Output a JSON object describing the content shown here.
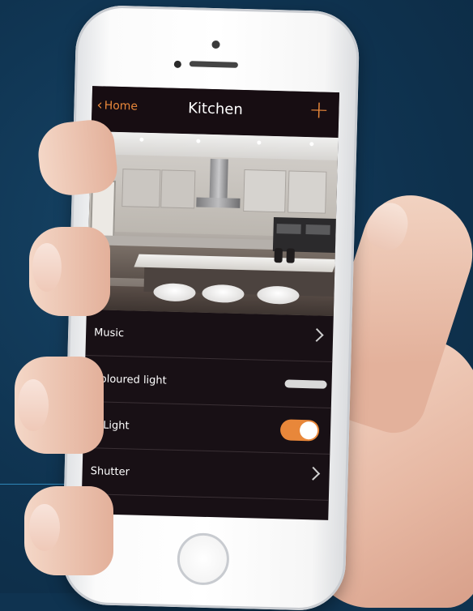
{
  "app": {
    "nav": {
      "back_label": "Home",
      "title": "Kitchen",
      "add_symbol": "+"
    },
    "rows": [
      {
        "label": "Music",
        "control": "chevron"
      },
      {
        "label": "Coloured light",
        "control": "slider"
      },
      {
        "label": "Light",
        "control": "toggle",
        "toggle_on": true
      },
      {
        "label": "Shutter",
        "control": "chevron"
      }
    ],
    "colors": {
      "accent": "#e8873a",
      "screen_bg": "#181015",
      "background": "#0f3350"
    },
    "icons": [
      "chevron-left-icon",
      "plus-icon",
      "chevron-right-icon",
      "drag-handle-icon",
      "toggle-switch"
    ]
  }
}
